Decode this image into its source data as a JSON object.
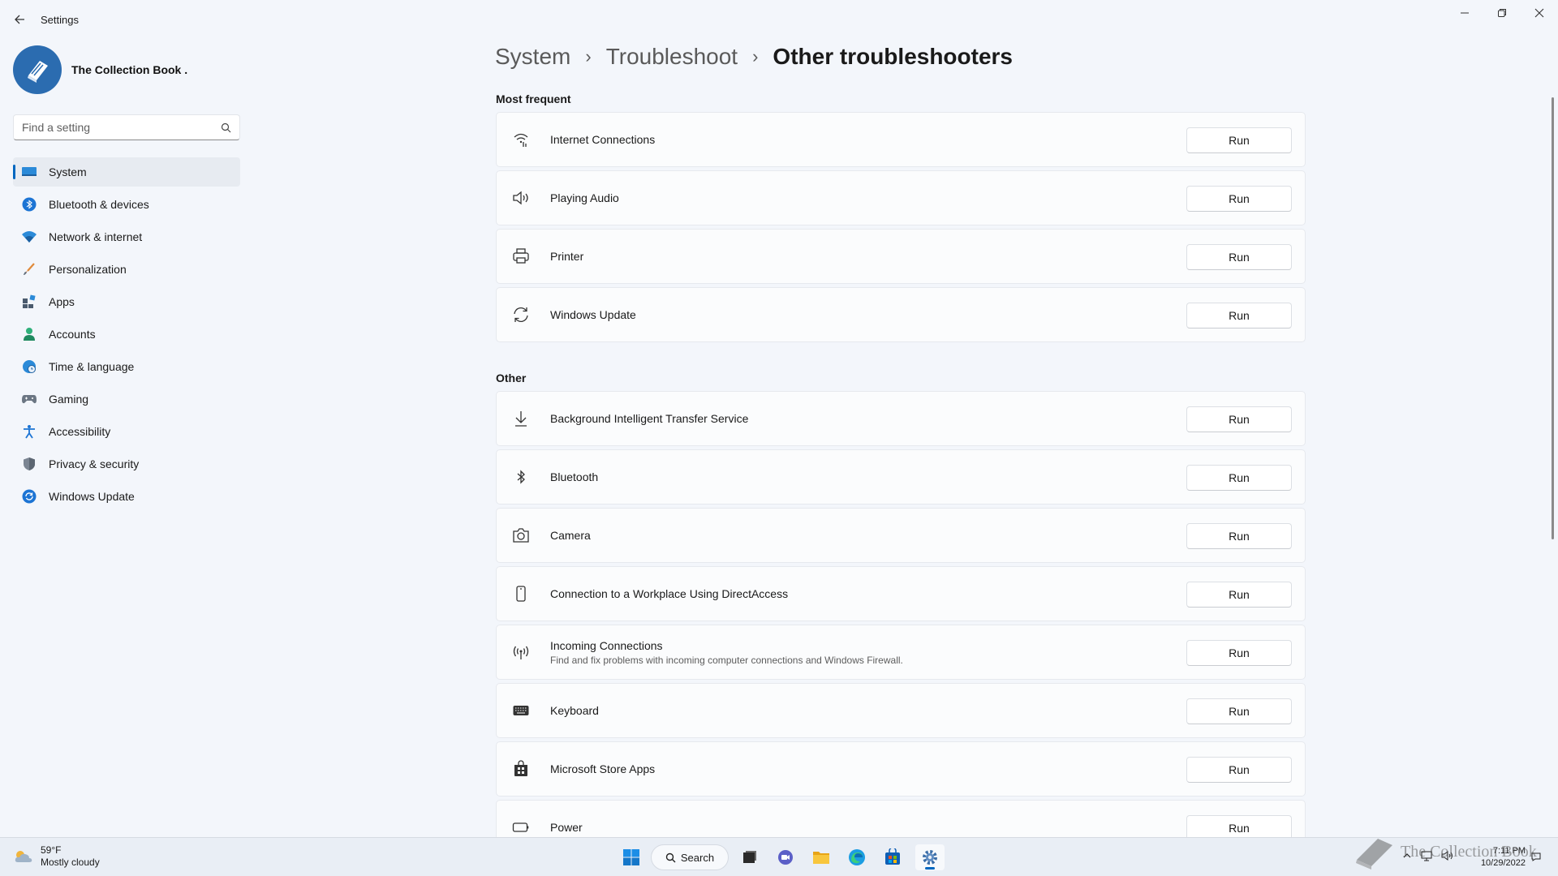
{
  "window": {
    "title": "Settings"
  },
  "profile": {
    "name": "The Collection Book ."
  },
  "search": {
    "placeholder": "Find a setting"
  },
  "sidebar": {
    "items": [
      {
        "label": "System",
        "icon": "system-icon",
        "active": true
      },
      {
        "label": "Bluetooth & devices",
        "icon": "bluetooth-icon"
      },
      {
        "label": "Network & internet",
        "icon": "wifi-icon"
      },
      {
        "label": "Personalization",
        "icon": "brush-icon"
      },
      {
        "label": "Apps",
        "icon": "apps-icon"
      },
      {
        "label": "Accounts",
        "icon": "person-icon"
      },
      {
        "label": "Time & language",
        "icon": "globe-clock-icon"
      },
      {
        "label": "Gaming",
        "icon": "gamepad-icon"
      },
      {
        "label": "Accessibility",
        "icon": "accessibility-icon"
      },
      {
        "label": "Privacy & security",
        "icon": "shield-icon"
      },
      {
        "label": "Windows Update",
        "icon": "update-icon"
      }
    ]
  },
  "breadcrumb": {
    "level1": "System",
    "level2": "Troubleshoot",
    "current": "Other troubleshooters"
  },
  "sections": {
    "most_frequent": "Most frequent",
    "other": "Other"
  },
  "run_label": "Run",
  "most_frequent": [
    {
      "title": "Internet Connections",
      "icon": "wifi-signal-icon"
    },
    {
      "title": "Playing Audio",
      "icon": "speaker-icon"
    },
    {
      "title": "Printer",
      "icon": "printer-icon"
    },
    {
      "title": "Windows Update",
      "icon": "refresh-icon"
    }
  ],
  "other": [
    {
      "title": "Background Intelligent Transfer Service",
      "icon": "download-icon"
    },
    {
      "title": "Bluetooth",
      "icon": "bluetooth-icon"
    },
    {
      "title": "Camera",
      "icon": "camera-icon"
    },
    {
      "title": "Connection to a Workplace Using DirectAccess",
      "icon": "phone-device-icon"
    },
    {
      "title": "Incoming Connections",
      "desc": "Find and fix problems with incoming computer connections and Windows Firewall.",
      "icon": "broadcast-icon"
    },
    {
      "title": "Keyboard",
      "icon": "keyboard-icon"
    },
    {
      "title": "Microsoft Store Apps",
      "icon": "store-icon"
    },
    {
      "title": "Power",
      "icon": "battery-icon"
    }
  ],
  "taskbar": {
    "weather_temp": "59°F",
    "weather_desc": "Mostly cloudy",
    "search_label": "Search",
    "time": "7:11 PM",
    "date": "10/29/2022",
    "accent": "#0067c0"
  },
  "watermark": {
    "text": "The Collection Book"
  }
}
